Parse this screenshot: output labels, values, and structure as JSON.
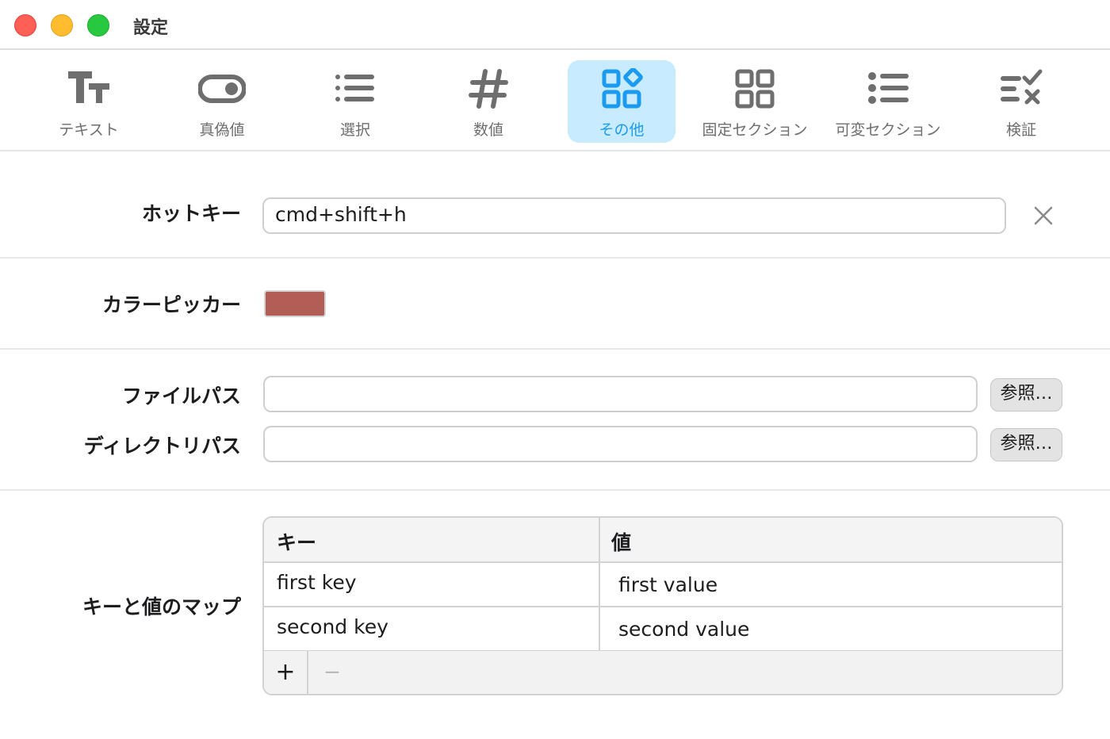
{
  "window": {
    "title": "設定"
  },
  "toolbar": {
    "items": [
      {
        "label": "テキスト",
        "icon": "text-icon",
        "active": false
      },
      {
        "label": "真偽値",
        "icon": "toggle-icon",
        "active": false
      },
      {
        "label": "選択",
        "icon": "list-icon",
        "active": false
      },
      {
        "label": "数値",
        "icon": "number-icon",
        "active": false
      },
      {
        "label": "その他",
        "icon": "other-icon",
        "active": true
      },
      {
        "label": "固定セクション",
        "icon": "grid-icon",
        "active": false
      },
      {
        "label": "可変セクション",
        "icon": "bullet-list-icon",
        "active": false
      },
      {
        "label": "検証",
        "icon": "validation-icon",
        "active": false
      }
    ],
    "accent_color": "#1a9bf0",
    "active_bg": "#c9ebff"
  },
  "form": {
    "hotkey": {
      "label": "ホットキー",
      "value": "cmd+shift+h"
    },
    "color_picker": {
      "label": "カラーピッカー",
      "color": "#b25e57"
    },
    "file_path": {
      "label": "ファイルパス",
      "value": "",
      "button": "参照…"
    },
    "directory_path": {
      "label": "ディレクトリパス",
      "value": "",
      "button": "参照…"
    },
    "key_value_map": {
      "label": "キーと値のマップ",
      "columns": [
        "キー",
        "値"
      ],
      "rows": [
        {
          "key": "first key",
          "value": "first value"
        },
        {
          "key": "second key",
          "value": "second value"
        }
      ],
      "add_label": "+",
      "remove_label": "−"
    }
  }
}
